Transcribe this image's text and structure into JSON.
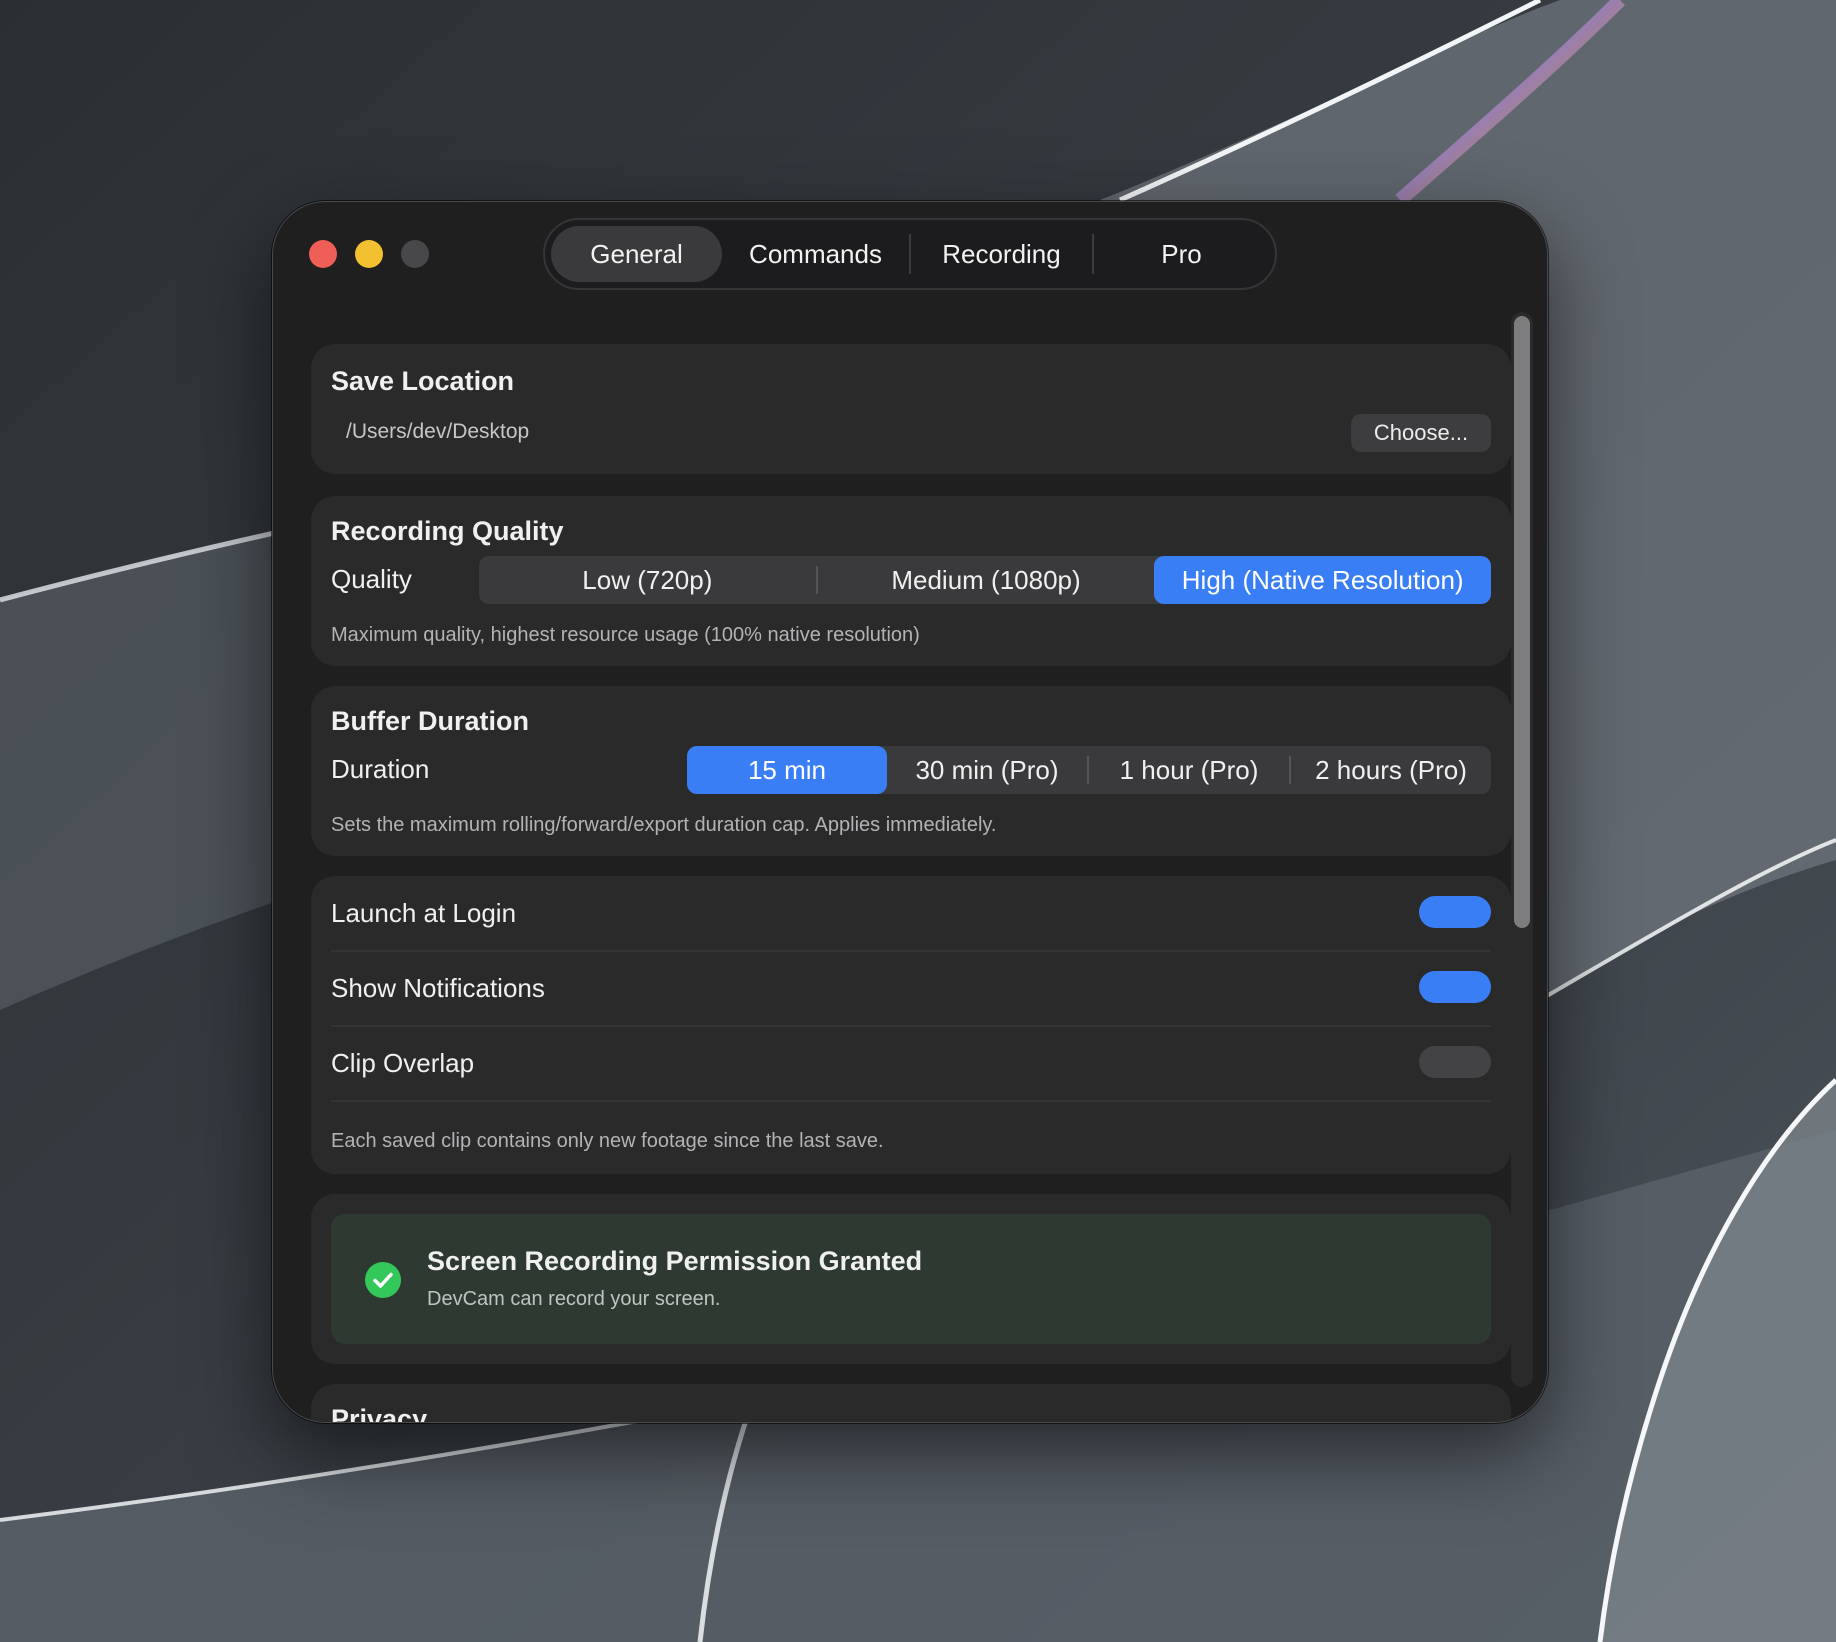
{
  "window": {
    "tabs": [
      {
        "label": "General",
        "active": true
      },
      {
        "label": "Commands",
        "active": false
      },
      {
        "label": "Recording",
        "active": false
      },
      {
        "label": "Pro",
        "active": false
      }
    ]
  },
  "save_location": {
    "title": "Save Location",
    "path": "/Users/dev/Desktop",
    "choose_label": "Choose..."
  },
  "recording_quality": {
    "title": "Recording Quality",
    "row_label": "Quality",
    "options": [
      "Low (720p)",
      "Medium (1080p)",
      "High (Native Resolution)"
    ],
    "selected": "High (Native Resolution)",
    "caption": "Maximum quality, highest resource usage (100% native resolution)"
  },
  "buffer_duration": {
    "title": "Buffer Duration",
    "row_label": "Duration",
    "options": [
      "15 min",
      "30 min (Pro)",
      "1 hour (Pro)",
      "2 hours (Pro)"
    ],
    "selected": "15 min",
    "caption": "Sets the maximum rolling/forward/export duration cap. Applies immediately."
  },
  "toggles": {
    "launch_at_login": {
      "label": "Launch at Login",
      "on": true
    },
    "show_notifications": {
      "label": "Show Notifications",
      "on": true
    },
    "clip_overlap": {
      "label": "Clip Overlap",
      "on": false
    },
    "caption": "Each saved clip contains only new footage since the last save."
  },
  "permission": {
    "title": "Screen Recording Permission Granted",
    "subtitle": "DevCam can record your screen."
  },
  "privacy": {
    "title": "Privacy"
  },
  "colors": {
    "accent": "#3a7ef6",
    "success": "#34c759",
    "window_bg": "#1f1f20",
    "card_bg": "#2a2a2b"
  },
  "icons": {
    "permission": "checkmark-circle-icon"
  }
}
